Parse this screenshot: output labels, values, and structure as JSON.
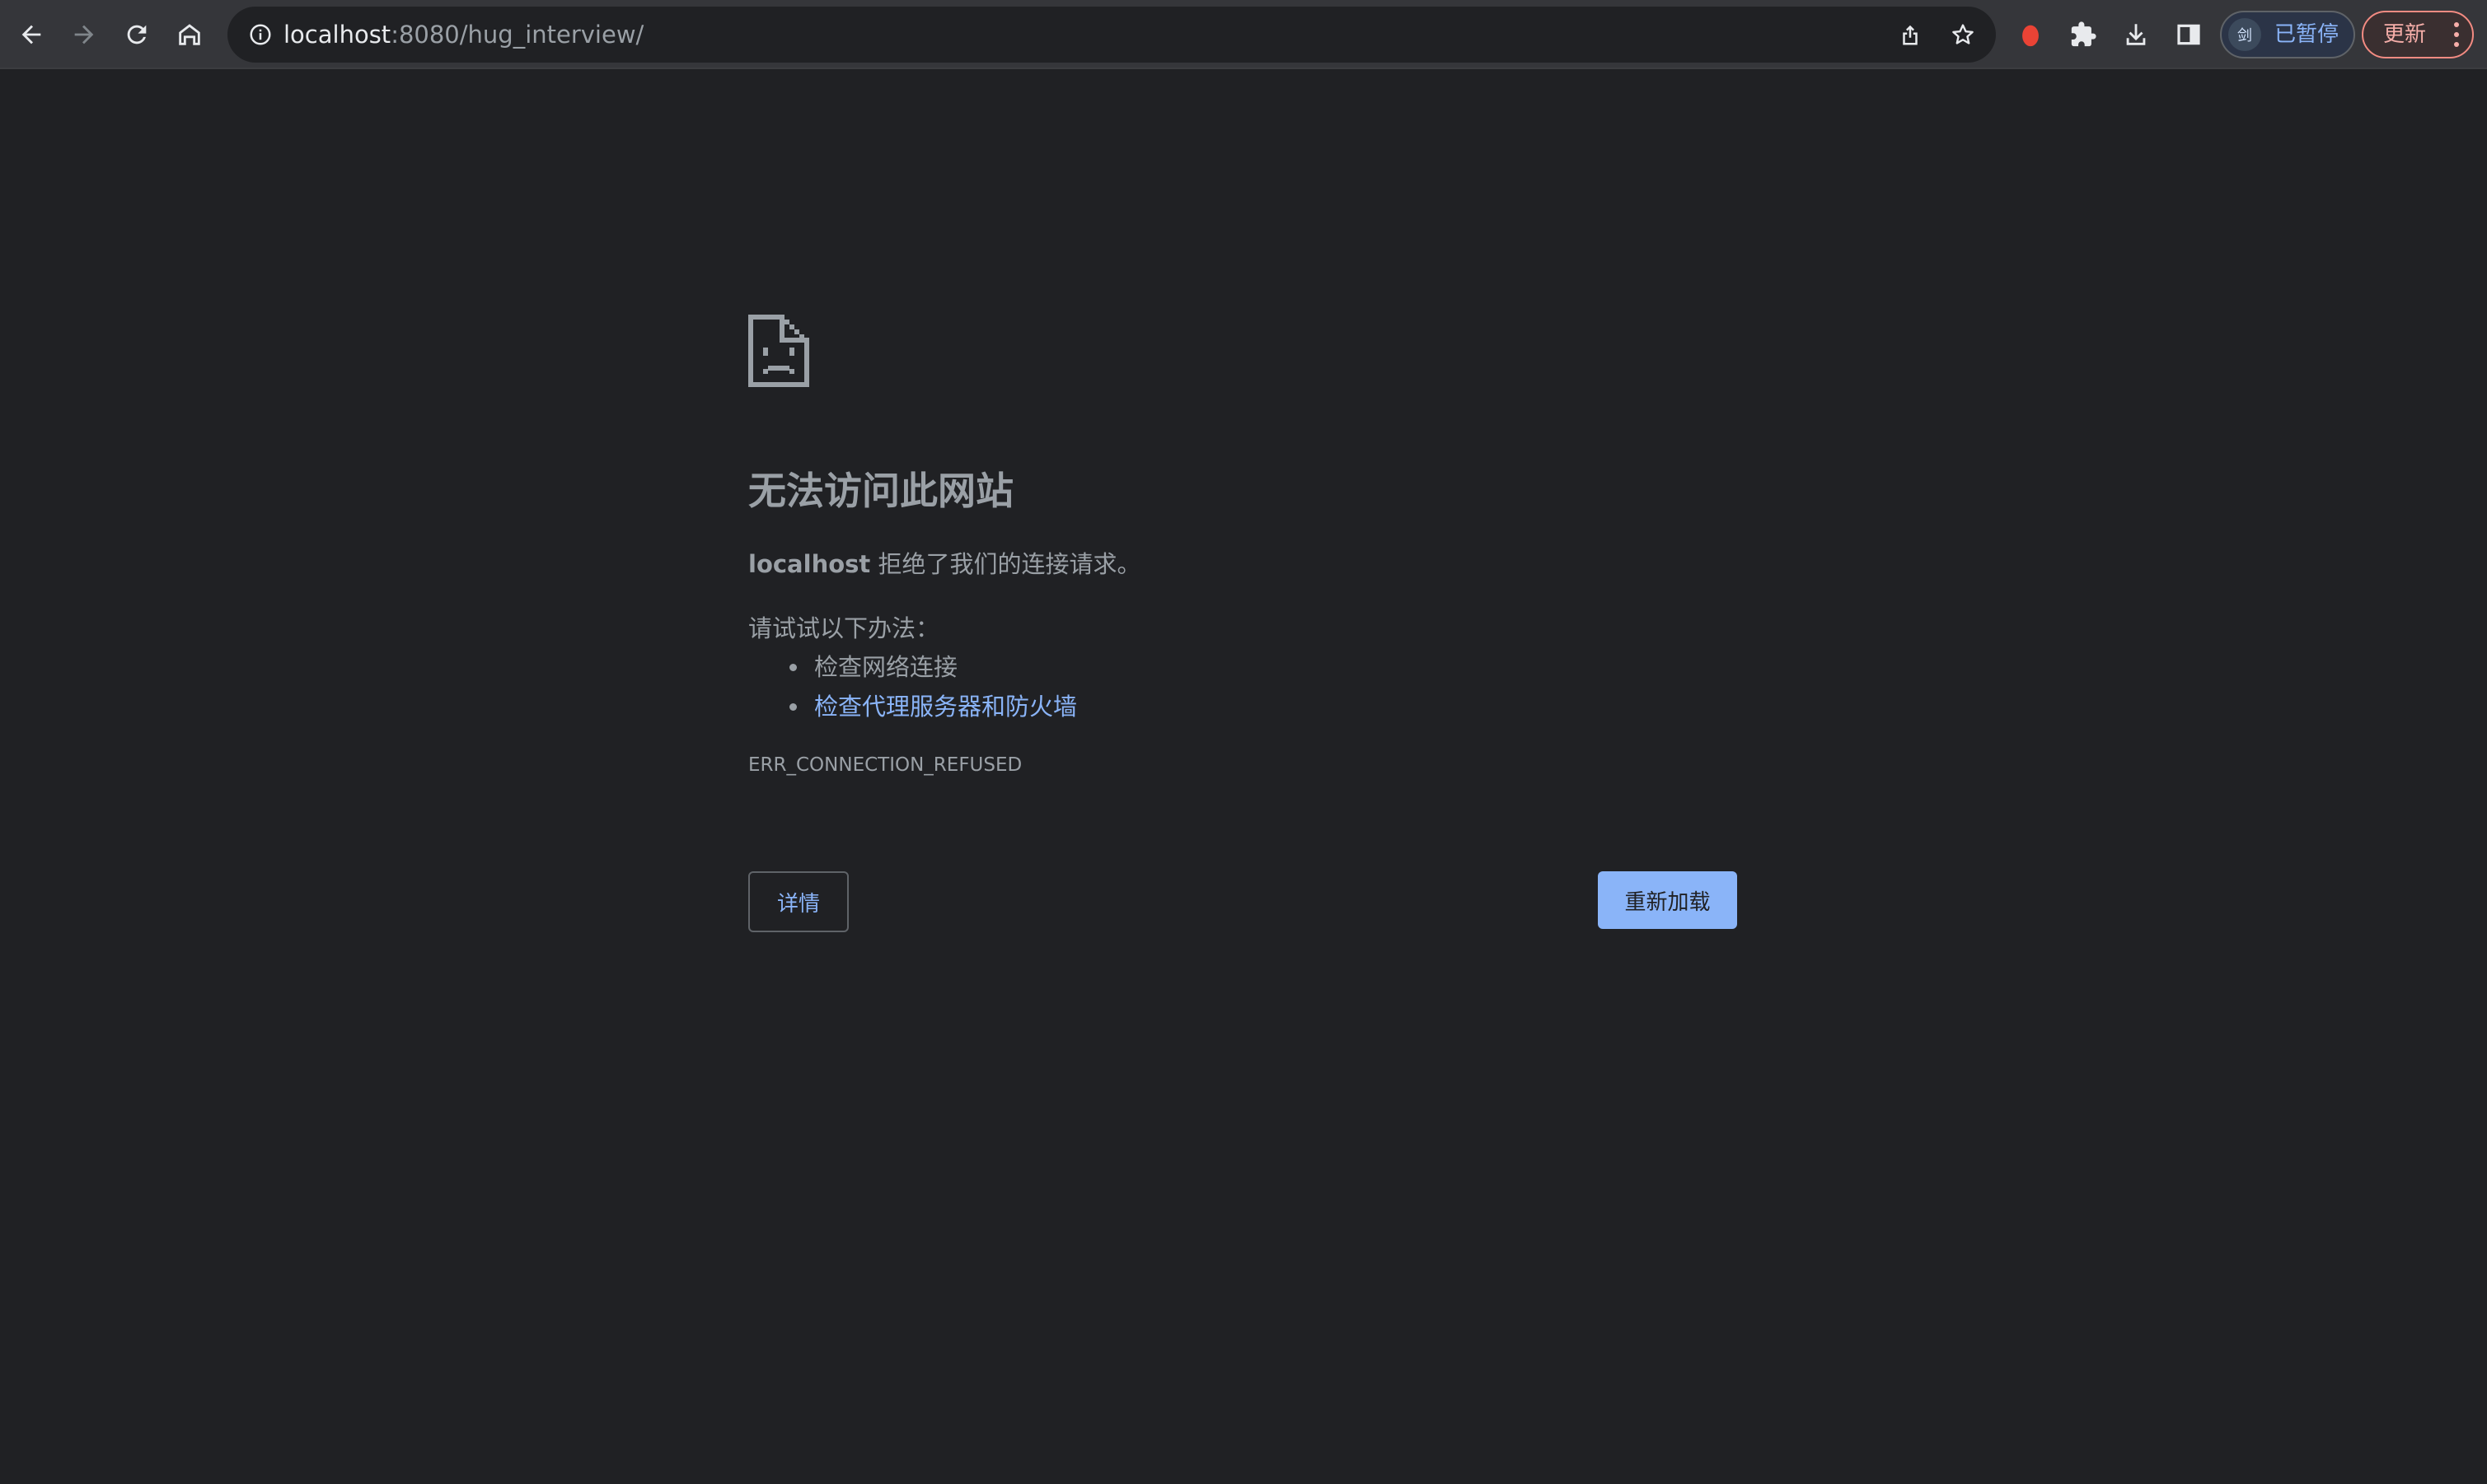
{
  "toolbar": {
    "back_icon": "arrow-left-icon",
    "forward_icon": "arrow-right-icon",
    "reload_icon": "reload-icon",
    "home_icon": "home-icon",
    "omnibox": {
      "info_icon": "info-circle-icon",
      "url_host": "localhost",
      "url_rest": ":8080/hug_interview/",
      "share_icon": "share-icon",
      "bookmark_icon": "star-icon"
    },
    "extension_icons": [
      "red-drop-extension-icon",
      "puzzle-icon",
      "download-icon",
      "side-panel-icon"
    ],
    "profile": {
      "avatar_text": "剑",
      "status_label": "已暂停"
    },
    "update": {
      "label": "更新",
      "menu_icon": "kebab-menu-icon"
    }
  },
  "error_page": {
    "icon": "sad-document-icon",
    "title": "无法访问此网站",
    "description_host": "localhost",
    "description_rest": " 拒绝了我们的连接请求。",
    "suggestions_heading": "请试试以下办法：",
    "suggestions": [
      {
        "label": "检查网络连接",
        "is_link": false
      },
      {
        "label": "检查代理服务器和防火墙",
        "is_link": true
      }
    ],
    "error_code": "ERR_CONNECTION_REFUSED",
    "details_button": "详情",
    "reload_button": "重新加载"
  },
  "colors": {
    "page_background": "#202124",
    "toolbar_background": "#35363a",
    "text_secondary": "#9aa0a6",
    "link_blue": "#8ab4f8",
    "update_red": "#f28b82"
  }
}
